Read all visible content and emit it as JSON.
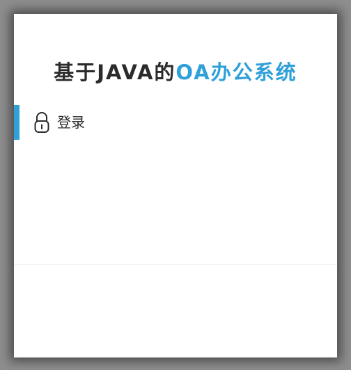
{
  "header": {
    "title_prefix": "基于JAVA的",
    "title_highlight": "OA办公系统"
  },
  "menu": {
    "items": [
      {
        "label": "登录",
        "icon": "lock-icon",
        "active": true
      }
    ]
  },
  "colors": {
    "accent": "#2fa0d8",
    "text": "#2b2b2b",
    "frame": "#8e8e8e"
  }
}
